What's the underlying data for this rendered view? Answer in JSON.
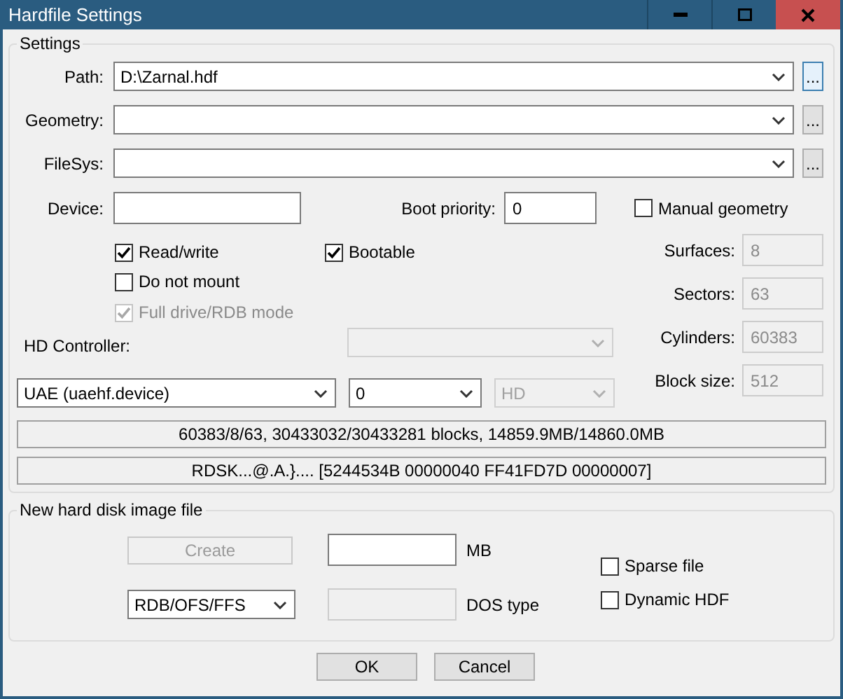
{
  "window": {
    "title": "Hardfile Settings"
  },
  "settings": {
    "title": "Settings",
    "file_fields": [
      {
        "label": "Path:",
        "value": "D:\\Zarnal.hdf",
        "button": "...",
        "focused": true
      },
      {
        "label": "Geometry:",
        "button": "...",
        "focused": false
      },
      {
        "label": "FileSys:",
        "button": "...",
        "focused": false
      }
    ],
    "device": {
      "label": "Device:"
    },
    "boot_priority": {
      "label": "Boot priority:",
      "value": "0"
    },
    "manual_geometry": {
      "label": "Manual geometry",
      "checked": false,
      "disabled": false
    },
    "read_write": {
      "label": "Read/write",
      "checked": true,
      "disabled": false
    },
    "bootable": {
      "label": "Bootable",
      "checked": true,
      "disabled": false
    },
    "do_not_mount": {
      "label": "Do not mount",
      "checked": false,
      "disabled": false
    },
    "full_drive": {
      "label": "Full drive/RDB mode",
      "checked": true,
      "disabled": true
    },
    "geometry": [
      {
        "label": "Surfaces:",
        "value": "8",
        "disabled": true
      },
      {
        "label": "Sectors:",
        "value": "63",
        "disabled": true
      },
      {
        "label": "Cylinders:",
        "value": "60383",
        "disabled": true
      },
      {
        "label": "Block size:",
        "value": "512",
        "disabled": true
      }
    ],
    "controller_label": "HD Controller:",
    "extra_combo": {
      "disabled": true
    },
    "controller": {
      "value": "UAE (uaehf.device)",
      "disabled": false
    },
    "unit": {
      "value": "0",
      "disabled": false
    },
    "type": {
      "value": "HD",
      "disabled": true
    },
    "info_lines": [
      "60383/8/63, 30433032/30433281 blocks, 14859.9MB/14860.0MB",
      "RDSK...@.A.}.... [5244534B 00000040 FF41FD7D 00000007]"
    ]
  },
  "new_image": {
    "title": "New hard disk image file",
    "create_button": {
      "label": "Create",
      "disabled": true
    },
    "size": {
      "unit_label": "MB",
      "disabled": false
    },
    "format": {
      "value": "RDB/OFS/FFS",
      "disabled": false
    },
    "dos_type": {
      "label": "DOS type",
      "disabled": true
    },
    "options": [
      {
        "label": "Sparse file",
        "checked": false,
        "disabled": false
      },
      {
        "label": "Dynamic HDF",
        "checked": false,
        "disabled": false
      }
    ]
  },
  "buttons": [
    "OK",
    "Cancel"
  ]
}
